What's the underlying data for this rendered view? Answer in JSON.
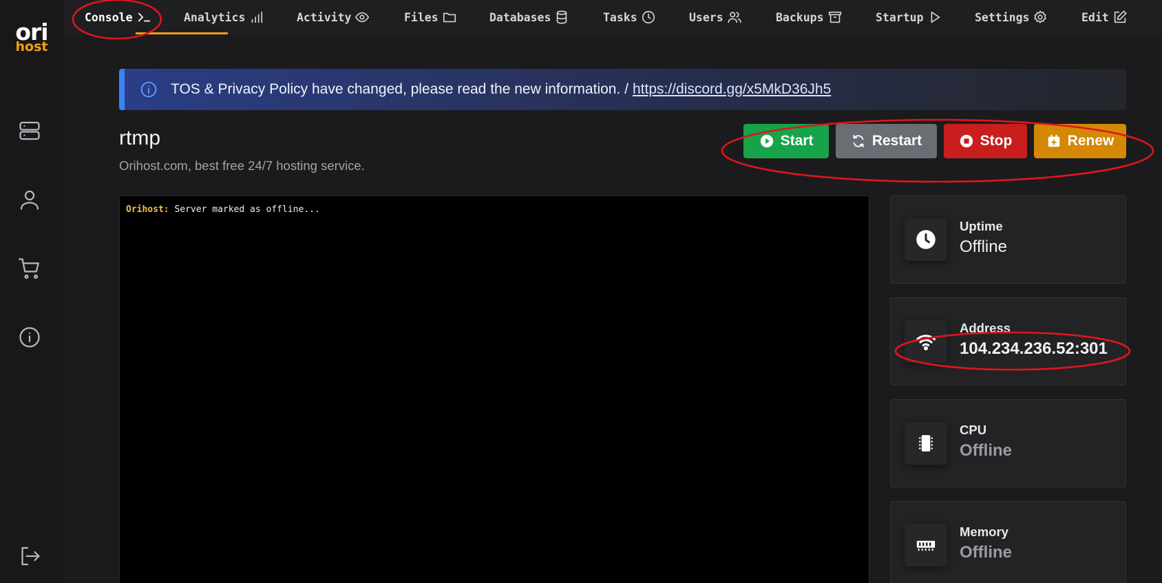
{
  "brand": {
    "logo_top": "ori",
    "logo_bottom": "host",
    "accent": "#f2a115"
  },
  "sidebar": {
    "items": [
      {
        "icon": "server-icon"
      },
      {
        "icon": "user-icon"
      },
      {
        "icon": "cart-icon"
      },
      {
        "icon": "info-icon"
      },
      {
        "icon": "logout-icon"
      }
    ]
  },
  "nav": {
    "tabs": [
      {
        "label": "Console",
        "icon": "terminal-icon",
        "active": true
      },
      {
        "label": "Analytics",
        "icon": "bar-chart-icon"
      },
      {
        "label": "Activity",
        "icon": "eye-icon"
      },
      {
        "label": "Files",
        "icon": "folder-icon"
      },
      {
        "label": "Databases",
        "icon": "database-icon"
      },
      {
        "label": "Tasks",
        "icon": "clock-icon"
      },
      {
        "label": "Users",
        "icon": "users-icon"
      },
      {
        "label": "Backups",
        "icon": "archive-icon"
      },
      {
        "label": "Startup",
        "icon": "play-icon"
      },
      {
        "label": "Settings",
        "icon": "gear-icon"
      },
      {
        "label": "Edit",
        "icon": "edit-icon"
      }
    ]
  },
  "alert": {
    "text": "TOS & Privacy Policy have changed, please read the new information. /",
    "link": "https://discord.gg/x5MkD36Jh5"
  },
  "server": {
    "name": "rtmp",
    "description": "Orihost.com, best free 24/7 hosting service."
  },
  "actions": {
    "start": "Start",
    "restart": "Restart",
    "stop": "Stop",
    "renew": "Renew"
  },
  "console": {
    "lines": [
      {
        "prefix": "Orihost:",
        "text": "Server marked as offline..."
      }
    ]
  },
  "stats": [
    {
      "label": "Uptime",
      "value": "Offline",
      "icon": "clock-icon"
    },
    {
      "label": "Address",
      "value": "104.234.236.52:301",
      "icon": "wifi-icon"
    },
    {
      "label": "CPU",
      "value": "Offline",
      "icon": "cpu-icon"
    },
    {
      "label": "Memory",
      "value": "Offline",
      "icon": "memory-icon"
    }
  ],
  "colors": {
    "start": "#17a34a",
    "restart": "#6b6d75",
    "stop": "#c81e1e",
    "renew": "#d48806",
    "annotation": "#e0161b"
  }
}
